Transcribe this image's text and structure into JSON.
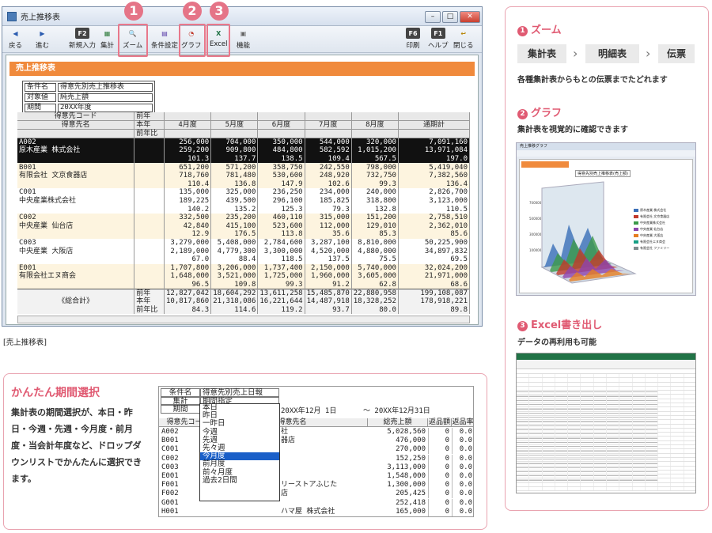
{
  "window": {
    "title": "売上推移表"
  },
  "toolbar": [
    {
      "key": "",
      "label": "戻る"
    },
    {
      "key": "",
      "label": "進む"
    },
    {
      "key": "F2",
      "label": "新規入力"
    },
    {
      "key": "",
      "label": "集計"
    },
    {
      "key": "",
      "label": "ズーム"
    },
    {
      "key": "",
      "label": "条件設定"
    },
    {
      "key": "",
      "label": "グラフ"
    },
    {
      "key": "",
      "label": "Excel"
    },
    {
      "key": "",
      "label": "機能"
    },
    {
      "key": "F6",
      "label": "印刷"
    },
    {
      "key": "F1",
      "label": "ヘルプ"
    },
    {
      "key": "",
      "label": "閉じる"
    }
  ],
  "markers": [
    "1",
    "2",
    "3"
  ],
  "report": {
    "title": "売上推移表",
    "conditions": [
      [
        "条件名",
        "得意先別売上推移表"
      ],
      [
        "対象値",
        "純売上額"
      ],
      [
        "期間",
        "20XX年度"
      ]
    ],
    "header": {
      "code": "得意先コード",
      "name": "得意先名",
      "row_labels": [
        "前年",
        "本年",
        "前年比"
      ],
      "months": [
        "4月度",
        "5月度",
        "6月度",
        "7月度",
        "8月度"
      ],
      "total": "通期計"
    },
    "rows": [
      {
        "code": "A002",
        "name": "原木産業 株式会社",
        "vals": [
          [
            "256,000",
            "704,000",
            "350,000",
            "544,000",
            "320,000",
            "7,091,160"
          ],
          [
            "259,200",
            "909,800",
            "484,800",
            "582,592",
            "1,015,200",
            "13,971,084"
          ],
          [
            "101.3",
            "137.7",
            "138.5",
            "109.4",
            "567.5",
            "197.0"
          ]
        ]
      },
      {
        "code": "B001",
        "name": "有限会社 文京食器店",
        "vals": [
          [
            "651,200",
            "571,200",
            "358,750",
            "242,550",
            "798,000",
            "5,419,040"
          ],
          [
            "718,760",
            "781,480",
            "530,600",
            "248,920",
            "732,750",
            "7,382,560"
          ],
          [
            "110.4",
            "136.8",
            "147.9",
            "102.6",
            "99.3",
            "136.4"
          ]
        ]
      },
      {
        "code": "C001",
        "name": "中央産業株式会社",
        "vals": [
          [
            "135,000",
            "325,000",
            "236,250",
            "234,000",
            "240,000",
            "2,826,700"
          ],
          [
            "189,225",
            "439,500",
            "296,100",
            "185,825",
            "318,800",
            "3,123,000"
          ],
          [
            "140.2",
            "135.2",
            "125.3",
            "79.3",
            "132.8",
            "110.5"
          ]
        ]
      },
      {
        "code": "C002",
        "name": "中央産業 仙台店",
        "vals": [
          [
            "332,500",
            "235,200",
            "460,110",
            "315,000",
            "151,200",
            "2,758,510"
          ],
          [
            "42,840",
            "415,100",
            "523,600",
            "112,000",
            "129,010",
            "2,362,010"
          ],
          [
            "12.9",
            "176.5",
            "113.8",
            "35.6",
            "85.3",
            "85.6"
          ]
        ]
      },
      {
        "code": "C003",
        "name": "中央産業 大阪店",
        "vals": [
          [
            "3,279,000",
            "5,408,000",
            "2,784,600",
            "3,287,100",
            "8,810,000",
            "50,225,900"
          ],
          [
            "2,189,000",
            "4,779,300",
            "3,300,000",
            "4,520,000",
            "4,880,000",
            "34,897,832"
          ],
          [
            "67.0",
            "88.4",
            "118.5",
            "137.5",
            "75.5",
            "69.5"
          ]
        ]
      },
      {
        "code": "E001",
        "name": "有限会社エヌ商会",
        "vals": [
          [
            "1,707,800",
            "3,206,000",
            "1,737,400",
            "2,150,000",
            "5,740,000",
            "32,024,200"
          ],
          [
            "1,648,000",
            "3,521,000",
            "1,725,000",
            "1,960,000",
            "3,605,000",
            "21,971,000"
          ],
          [
            "96.5",
            "109.8",
            "99.3",
            "91.2",
            "62.8",
            "68.6"
          ]
        ]
      }
    ],
    "total": {
      "label": "《総合計》",
      "row_labels": [
        "前年",
        "本年",
        "前年比"
      ],
      "vals": [
        [
          "12,827,042",
          "18,604,292",
          "13,611,258",
          "15,485,870",
          "22,880,958",
          "199,108,087"
        ],
        [
          "10,817,860",
          "21,318,086",
          "16,221,644",
          "14,487,918",
          "18,328,252",
          "178,918,221"
        ],
        [
          "84.3",
          "114.6",
          "119.2",
          "93.7",
          "80.0",
          "89.8"
        ]
      ]
    }
  },
  "caption": "[売上推移表]",
  "panel": {
    "zoom": {
      "num": "1",
      "title": "ズーム",
      "crumbs": [
        "集計表",
        "明細表",
        "伝票"
      ],
      "desc": "各種集計表からもとの伝票までたどれます"
    },
    "graph": {
      "num": "2",
      "title": "グラフ",
      "desc": "集計表を視覚的に確認できます",
      "window_title": "売上推移グラフ",
      "chart_title": "得意先別売上推移表(売上額)",
      "legend": [
        "原木産業 株式会社",
        "有限会社 文京食器店",
        "中央産業株式会社",
        "中央産業 仙台店",
        "中央産業 大阪店",
        "有限会社エヌ商会",
        "有限会社 ファミリー"
      ]
    },
    "excel": {
      "num": "3",
      "title": "Excel書き出し",
      "desc": "データの再利用も可能"
    }
  },
  "period": {
    "title": "かんたん期間選択",
    "desc": "集計表の期間選択が、本日・昨日・今週・先週・今月度・前月度・当会計年度など、ドロップダウンリストでかんたんに選択できます。",
    "cond_rows": [
      [
        "条件名",
        "得意先別売上日報"
      ],
      [
        "集計",
        "期間指定"
      ],
      [
        "期間",
        "今月度"
      ]
    ],
    "from": "20XX年12月 1日",
    "to": "～ 20XX年12月31日",
    "cols": [
      "得意先コード",
      "得意先名",
      "総売上額",
      "返品額",
      "返品率"
    ],
    "options": [
      "本日",
      "昨日",
      "一昨日",
      "今週",
      "先週",
      "先々週",
      "今月度",
      "前月度",
      "前々月度",
      "過去2日間"
    ],
    "rows": [
      {
        "code": "A002",
        "name": "社",
        "total": "5,028,560",
        "ret": "0",
        "rate": "0.0"
      },
      {
        "code": "B001",
        "name": "器店",
        "total": "476,000",
        "ret": "0",
        "rate": "0.0"
      },
      {
        "code": "C001",
        "name": "",
        "total": "270,000",
        "ret": "0",
        "rate": "0.0"
      },
      {
        "code": "C002",
        "name": "",
        "total": "152,250",
        "ret": "0",
        "rate": "0.0"
      },
      {
        "code": "C003",
        "name": "",
        "total": "3,113,000",
        "ret": "0",
        "rate": "0.0"
      },
      {
        "code": "E001",
        "name": "",
        "total": "1,548,000",
        "ret": "0",
        "rate": "0.0"
      },
      {
        "code": "F001",
        "name": "リーストアふじた",
        "total": "1,300,000",
        "ret": "0",
        "rate": "0.0"
      },
      {
        "code": "F002",
        "name": "店",
        "total": "205,425",
        "ret": "0",
        "rate": "0.0"
      },
      {
        "code": "G001",
        "name": "",
        "total": "252,418",
        "ret": "0",
        "rate": "0.0"
      },
      {
        "code": "H001",
        "name": "ハマ屋 株式会社",
        "total": "165,000",
        "ret": "0",
        "rate": "0.0"
      }
    ]
  }
}
